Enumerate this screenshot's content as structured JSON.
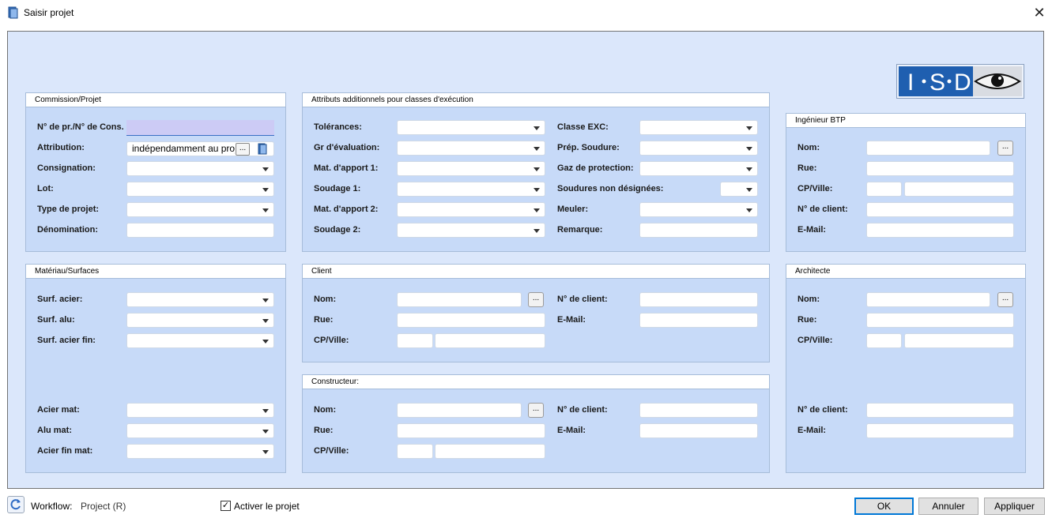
{
  "window": {
    "title": "Saisir projet",
    "close_glyph": "✕"
  },
  "commission": {
    "title": "Commission/Projet",
    "labels": {
      "pr": "N° de pr./N° de Cons.",
      "attribution": "Attribution:",
      "consignation": "Consignation:",
      "lot": "Lot:",
      "type": "Type de projet:",
      "denomination": "Dénomination:"
    },
    "attribution_value": "indépendamment au projet",
    "attribution_button": "..."
  },
  "attributs": {
    "title": "Attributs additionnels pour classes d'exécution",
    "left_labels": [
      "Tolérances:",
      "Gr d'évaluation:",
      "Mat. d'apport 1:",
      "Soudage 1:",
      "Mat. d'apport 2:",
      "Soudage 2:"
    ],
    "right_labels": [
      "Classe EXC:",
      "Prép. Soudure:",
      "Gaz de protection:",
      "Soudures non désignées:",
      "Meuler:",
      "Remarque:"
    ]
  },
  "ingenieur": {
    "title": "Ingénieur BTP",
    "labels": {
      "nom": "Nom:",
      "rue": "Rue:",
      "cpville": "CP/Ville:",
      "client": "N° de client:",
      "email": "E-Mail:"
    },
    "button": "..."
  },
  "materiau": {
    "title": "Matériau/Surfaces",
    "labels": {
      "surf_acier": "Surf. acier:",
      "surf_alu": "Surf. alu:",
      "surf_acier_fin": "Surf. acier fin:",
      "acier_mat": "Acier mat:",
      "alu_mat": "Alu mat:",
      "acier_fin_mat": "Acier fin mat:"
    }
  },
  "client": {
    "title": "Client",
    "labels": {
      "nom": "Nom:",
      "rue": "Rue:",
      "cpville": "CP/Ville:",
      "client": "N° de client:",
      "email": "E-Mail:"
    },
    "button": "..."
  },
  "constructeur": {
    "title": "Constructeur:",
    "labels": {
      "nom": "Nom:",
      "rue": "Rue:",
      "cpville": "CP/Ville:",
      "client": "N° de client:",
      "email": "E-Mail:"
    },
    "button": "..."
  },
  "architecte": {
    "title": "Architecte",
    "labels": {
      "nom": "Nom:",
      "rue": "Rue:",
      "cpville": "CP/Ville:",
      "client": "N° de client:",
      "email": "E-Mail:"
    },
    "button": "..."
  },
  "logo": {
    "letters": [
      "I",
      "S",
      "D"
    ]
  },
  "footer": {
    "workflow_label": "Workflow:",
    "workflow_value": "Project (R)",
    "activate_label": "Activer le projet",
    "activate_checked": "✓",
    "ok": "OK",
    "cancel": "Annuler",
    "apply": "Appliquer"
  },
  "colors": {
    "panel": "#c7daf8",
    "background": "#dbe7fb",
    "accent": "#0078d7",
    "logo_blue": "#1f5fb0"
  }
}
